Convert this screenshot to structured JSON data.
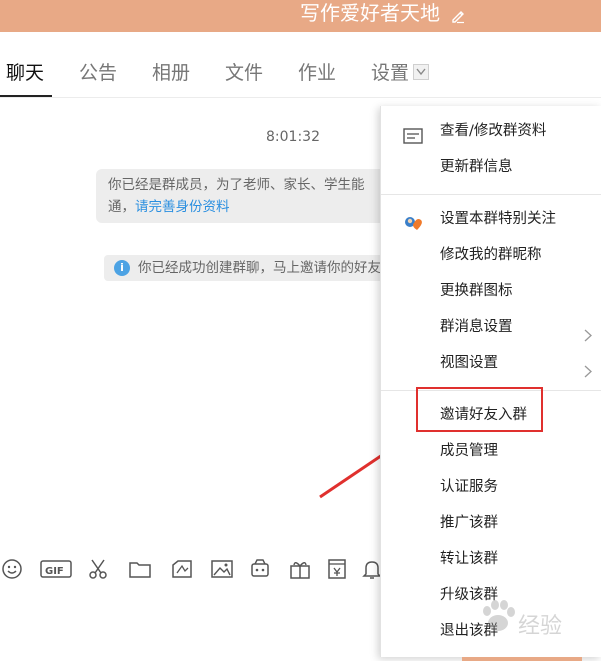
{
  "header": {
    "title": "写作爱好者天地",
    "bg_color": "#e8a986"
  },
  "tabs": [
    {
      "label": "聊天",
      "active": true
    },
    {
      "label": "公告"
    },
    {
      "label": "相册"
    },
    {
      "label": "文件"
    },
    {
      "label": "作业"
    },
    {
      "label": "设置"
    }
  ],
  "chat": {
    "timestamp": "8:01:32",
    "member_notice_line1": "你已经是群成员，为了老师、家长、学生能",
    "member_notice_line2_prefix": "通，",
    "member_notice_link": "请完善身份资料",
    "created_notice": "你已经成功创建群聊，马上邀请你的好友"
  },
  "toolbar": {
    "icons": [
      "emoji-icon",
      "gif-icon",
      "scissors-icon",
      "folder-icon",
      "doodle-icon",
      "image-icon",
      "shake-icon",
      "gift-icon",
      "vote-icon",
      "bell-icon"
    ]
  },
  "menu": {
    "items": [
      {
        "label": "查看/修改群资料",
        "icon": "profile-card-icon"
      },
      {
        "label": "更新群信息"
      },
      {
        "label": "设置本群特别关注",
        "icon": "special-care-icon"
      },
      {
        "label": "修改我的群昵称"
      },
      {
        "label": "更换群图标"
      },
      {
        "label": "群消息设置",
        "submenu": true
      },
      {
        "label": "视图设置",
        "submenu": true
      },
      {
        "label": "邀请好友入群",
        "highlighted": true
      },
      {
        "label": "成员管理"
      },
      {
        "label": "认证服务"
      },
      {
        "label": "推广该群"
      },
      {
        "label": "转让该群"
      },
      {
        "label": "升级该群"
      },
      {
        "label": "退出该群"
      }
    ]
  },
  "watermark": {
    "text": "经验"
  },
  "colors": {
    "accent": "#e8a986",
    "link": "#2a8fe0",
    "highlight": "#e0302e"
  }
}
